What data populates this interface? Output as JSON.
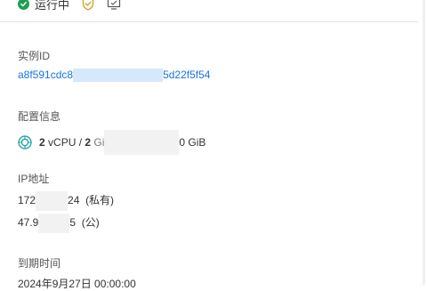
{
  "status": {
    "text": "运行中",
    "color": "#1f9d55",
    "icons": [
      "check-circle-icon",
      "shield-check-icon",
      "monitor-icon"
    ]
  },
  "instance": {
    "label": "实例ID",
    "id_prefix": "a8f591cdc8",
    "id_suffix": "5d22f5f54"
  },
  "config": {
    "label": "配置信息",
    "cpu_count": "2",
    "cpu_unit": "vCPU /",
    "mem_count": "2",
    "mem_partial": "Gi",
    "tail_text": "0 GiB",
    "icon": "chip-icon"
  },
  "ip": {
    "label": "IP地址",
    "private_prefix": "172",
    "private_suffix": "24",
    "private_tag": "(私有)",
    "public_prefix": "47.9",
    "public_suffix": "5",
    "public_tag": "(公)"
  },
  "expire": {
    "label": "到期时间",
    "value": "2024年9月27日 00:00:00"
  },
  "colors": {
    "link": "#1a73e8",
    "highlight": "#d6e8fb"
  }
}
